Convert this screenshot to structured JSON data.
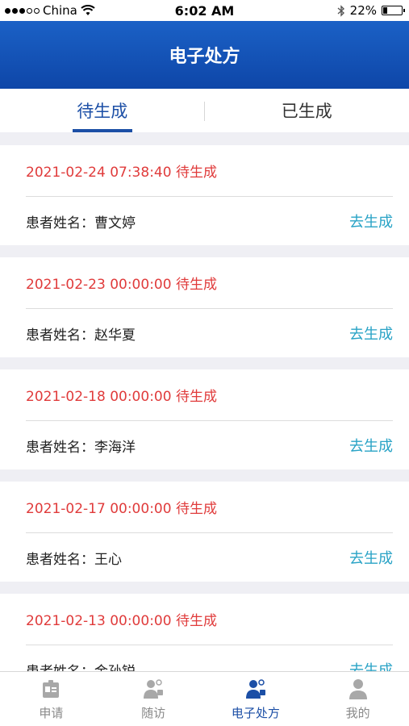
{
  "status_bar": {
    "carrier": "China",
    "time": "6:02 AM",
    "battery": "22%",
    "battery_level": 0.22
  },
  "header": {
    "title": "电子处方"
  },
  "tabs": [
    {
      "label": "待生成",
      "active": true
    },
    {
      "label": "已生成",
      "active": false
    }
  ],
  "prescriptions": [
    {
      "datetime_status": "2021-02-24 07:38:40 待生成",
      "patient_label": "患者姓名：曹文婷",
      "action": "去生成"
    },
    {
      "datetime_status": "2021-02-23 00:00:00 待生成",
      "patient_label": "患者姓名：赵华夏",
      "action": "去生成"
    },
    {
      "datetime_status": "2021-02-18 00:00:00 待生成",
      "patient_label": "患者姓名：李海洋",
      "action": "去生成"
    },
    {
      "datetime_status": "2021-02-17 00:00:00 待生成",
      "patient_label": "患者姓名：王心",
      "action": "去生成"
    },
    {
      "datetime_status": "2021-02-13 00:00:00 待生成",
      "patient_label": "患者姓名：金孙锐",
      "action": "去生成"
    }
  ],
  "tab_bar": [
    {
      "label": "申请",
      "icon": "id-card-icon",
      "active": false
    },
    {
      "label": "随访",
      "icon": "follow-up-icon",
      "active": false
    },
    {
      "label": "电子处方",
      "icon": "prescription-icon",
      "active": true
    },
    {
      "label": "我的",
      "icon": "user-icon",
      "active": false
    }
  ],
  "colors": {
    "nav": "#0e46a8",
    "accent": "#1c4fa6",
    "date_red": "#e03b3b",
    "action_teal": "#29a3c6"
  }
}
